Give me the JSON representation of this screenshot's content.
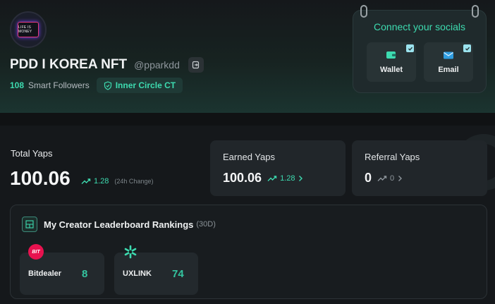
{
  "profile": {
    "avatar_text": "LIFE IS MONEY",
    "display_name": "PDD I KOREA NFT",
    "handle": "@pparkdd",
    "followers_count": "108",
    "followers_label": "Smart Followers",
    "badge_label": "Inner Circle CT"
  },
  "socials": {
    "title": "Connect your socials",
    "items": [
      {
        "label": "Wallet",
        "icon": "wallet-icon",
        "connected": true
      },
      {
        "label": "Email",
        "icon": "email-icon",
        "connected": true
      }
    ]
  },
  "stats": {
    "total": {
      "label": "Total Yaps",
      "value": "100.06",
      "change": "1.28",
      "change_note": "(24h Change)"
    },
    "earned": {
      "label": "Earned Yaps",
      "value": "100.06",
      "change": "1.28"
    },
    "referral": {
      "label": "Referral Yaps",
      "value": "0",
      "change": "0"
    }
  },
  "leaderboard": {
    "title": "My Creator Leaderboard Rankings",
    "period": "(30D)",
    "items": [
      {
        "name": "Bitdealer",
        "rank": "8",
        "logo_text": "BIT"
      },
      {
        "name": "UXLINK",
        "rank": "74"
      }
    ]
  },
  "colors": {
    "accent": "#3ddbb0",
    "background": "#15181b",
    "card": "#21262a"
  }
}
